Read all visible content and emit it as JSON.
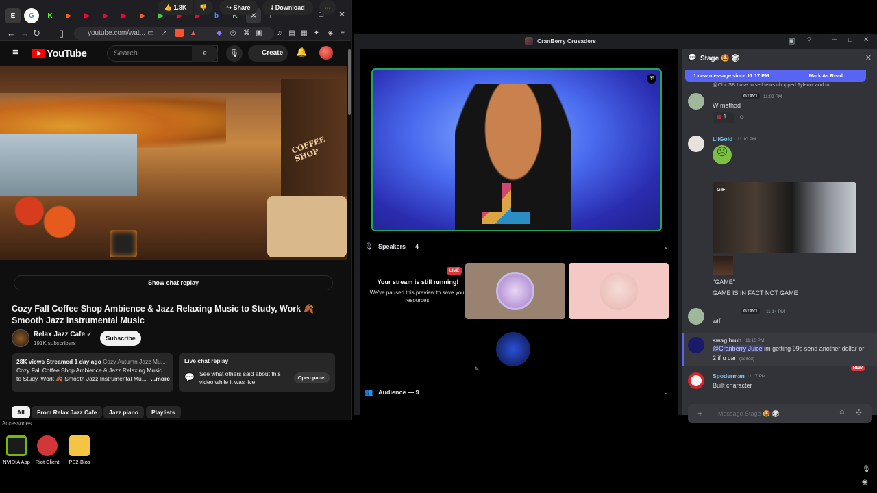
{
  "browser": {
    "tabs": [
      "E",
      "G",
      "K",
      "▶",
      "▶",
      "▶",
      "▶",
      "▶",
      "▶",
      "▶",
      "▶",
      "b",
      "K"
    ],
    "new_tab": "+",
    "url": "youtube.com/wat...",
    "winctl": [
      "─",
      "□",
      "✕"
    ]
  },
  "youtube": {
    "logo_text": "YouTube",
    "search_placeholder": "Search",
    "create_label": "Create",
    "video": {
      "sign_text": "COFFEE SHOP",
      "show_chat_replay": "Show chat replay",
      "title": "Cozy Fall Coffee Shop Ambience & Jazz Relaxing Music to Study, Work 🍂 Smooth Jazz Instrumental Music",
      "channel": "Relax Jazz Cafe",
      "subscribers": "191K subscribers",
      "subscribe_label": "Subscribe",
      "likes": "1.8K",
      "share_label": "Share",
      "download_label": "Download",
      "description": {
        "line1_bold": "28K views  Streamed 1 day ago",
        "line1_rest": "Cozy Autumn Jazz Mu...",
        "line2": "Cozy Fall Coffee Shop Ambience & Jazz Relaxing Music",
        "line3": "to Study, Work 🍂 Smooth Jazz Instrumental Mu...",
        "more": "...more"
      },
      "live_chat_replay": {
        "title": "Live chat replay",
        "text": "See what others said about this video while it was live.",
        "button": "Open panel"
      },
      "chips": [
        "All",
        "From Relax Jazz Cafe",
        "Jazz piano",
        "Playlists"
      ]
    }
  },
  "desktop": {
    "folder_label": "Accessories",
    "icons": [
      {
        "label": "NVIDIA App",
        "color": "#76b900"
      },
      {
        "label": "Riot Client",
        "color": "#d13639"
      },
      {
        "label": "PS2-Bios",
        "color": "#f4c542"
      }
    ]
  },
  "discord": {
    "window_title": "CranBerry Crusaders",
    "stage": {
      "speakers_header": "Speakers — 4",
      "audience_header": "Audience — 9",
      "live_badge": "LIVE",
      "stream_title": "Your stream is still running!",
      "stream_text": "We've paused this preview to save your resources."
    },
    "chat": {
      "header": "Stage 🤩 🎲",
      "new_messages": "1 new message since 11:17 PM",
      "mark_read": "Mark As Read",
      "reply_preview": "@ChipSB  I use to sell feins chopped Tylenol and tol...",
      "messages": [
        {
          "name": "",
          "tag": "GTAV1",
          "time": "11:09 PM",
          "text": "W method",
          "reaction": "1"
        },
        {
          "name": "LilGold",
          "time": "11:10 PM",
          "gif_label": "GIF"
        },
        {
          "text1": "\"GAME\"",
          "text2": "GAME IS IN FACT NOT GAME"
        },
        {
          "name": "",
          "tag": "GTAV1",
          "time": "11:14 PM",
          "text": "wtf"
        },
        {
          "name": "swag bruh",
          "time": "11:16 PM",
          "mention": "@Cranberry Juice",
          "text": " im getting 99s send another dollar or 2 if u can",
          "edited": "(edited)"
        },
        {
          "name": "Spoderman",
          "time": "11:17 PM",
          "text": "Built character",
          "badge": "NEW"
        }
      ],
      "composer_placeholder": "Message Stage 🤩 🎲"
    }
  }
}
